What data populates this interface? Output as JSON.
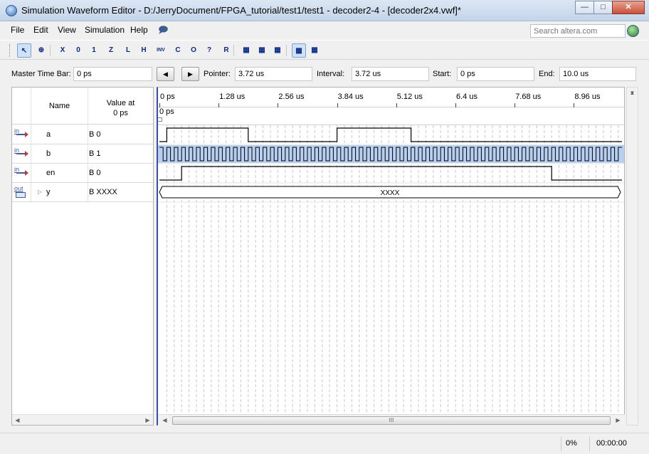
{
  "window": {
    "title": "Simulation Waveform Editor - D:/JerryDocument/FPGA_tutorial/test1/test1 - decoder2-4 - [decoder2x4.vwf]*",
    "controls": [
      "minimize-icon",
      "maximize-icon",
      "close-icon"
    ]
  },
  "menu": {
    "items": [
      {
        "label": "File"
      },
      {
        "label": "Edit"
      },
      {
        "label": "View"
      },
      {
        "label": "Simulation"
      },
      {
        "label": "Help"
      }
    ],
    "search_placeholder": "Search altera.com"
  },
  "toolbar": {
    "buttons": [
      {
        "icon": "selection-tool-icon",
        "text": "",
        "selected": true
      },
      {
        "icon": "zoom-tool-icon",
        "text": ""
      },
      {
        "icon": "uninitialized-icon",
        "text": "X"
      },
      {
        "icon": "force-low-icon",
        "text": "0"
      },
      {
        "icon": "force-high-icon",
        "text": "1"
      },
      {
        "icon": "high-impedance-icon",
        "text": "Z"
      },
      {
        "icon": "weak-low-icon",
        "text": "L"
      },
      {
        "icon": "weak-high-icon",
        "text": "H"
      },
      {
        "icon": "invert-icon",
        "text": "INV"
      },
      {
        "icon": "count-value-icon",
        "text": "C"
      },
      {
        "icon": "overwrite-clock-icon",
        "text": "O"
      },
      {
        "icon": "arbitrary-value-icon",
        "text": "?"
      },
      {
        "icon": "random-value-icon",
        "text": "R"
      },
      {
        "icon": "functional-simulation-icon",
        "text": ""
      },
      {
        "icon": "timing-simulation-icon",
        "text": ""
      },
      {
        "icon": "netlist-icon",
        "text": ""
      },
      {
        "icon": "snap-to-grid-icon",
        "text": "",
        "selected": true
      },
      {
        "icon": "grid-icon",
        "text": ""
      }
    ]
  },
  "timebar": {
    "master_label": "Master Time Bar:",
    "master_value": "0 ps",
    "pointer_label": "Pointer:",
    "pointer_value": "3.72 us",
    "interval_label": "Interval:",
    "interval_value": "3.72 us",
    "start_label": "Start:",
    "start_value": "0 ps",
    "end_label": "End:",
    "end_value": "10.0 us"
  },
  "table": {
    "col_name": "Name",
    "col_value_line1": "Value at",
    "col_value_line2": "0 ps",
    "signals": [
      {
        "dir": "in",
        "name": "a",
        "value": "B 0"
      },
      {
        "dir": "in",
        "name": "b",
        "value": "B 1"
      },
      {
        "dir": "in",
        "name": "en",
        "value": "B 0"
      },
      {
        "dir": "out",
        "name": "y",
        "value": "B XXXX",
        "expandable": true
      }
    ]
  },
  "ruler": {
    "ticks": [
      "0 ps",
      "1.28 us",
      "2.56 us",
      "3.84 us",
      "5.12 us",
      "6.4 us",
      "7.68 us",
      "8.96 us"
    ],
    "marker_label": "0 ps"
  },
  "waveforms": {
    "end_time_us": 10.0,
    "a_transitions_us": [
      0.16,
      1.92,
      3.84,
      5.44
    ],
    "a_initial": 0,
    "b_clock_period_us": 0.16,
    "en_transitions_us": [
      0.48,
      8.48
    ],
    "en_initial": 0,
    "y_bus_value": "XXXX"
  },
  "scroll": {
    "hthumb_grip": "III"
  },
  "status": {
    "progress": "0%",
    "elapsed": "00:00:00"
  }
}
